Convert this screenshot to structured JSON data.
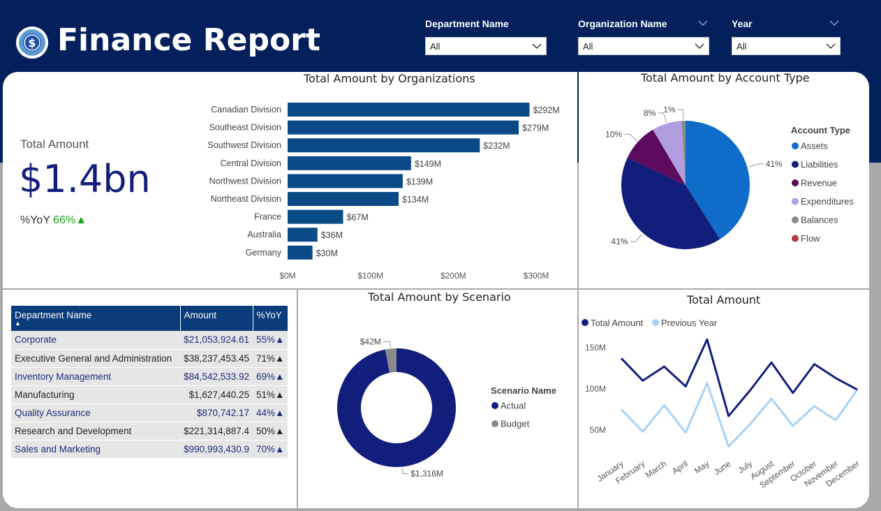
{
  "header": {
    "title": "Finance Report",
    "slicers": [
      {
        "label": "Department Name",
        "value": "All"
      },
      {
        "label": "Organization Name",
        "value": "All"
      },
      {
        "label": "Year",
        "value": "All"
      }
    ]
  },
  "kpi": {
    "label": "Total Amount",
    "value": "$1.4bn",
    "yoy_label": "%YoY",
    "yoy_value": "66%",
    "yoy_arrow": "▲"
  },
  "colors": {
    "header_bg": "#03205c",
    "bar": "#0a4a87",
    "navy": "#121e7c",
    "green": "#1aa31a",
    "light_blue": "#a7d2f5"
  },
  "chart_data": [
    {
      "type": "bar",
      "orientation": "horizontal",
      "title": "Total Amount by Organizations",
      "categories": [
        "Canadian Division",
        "Southeast Division",
        "Southwest Division",
        "Central Division",
        "Northwest Division",
        "Northeast Division",
        "France",
        "Australia",
        "Germany"
      ],
      "values": [
        292,
        279,
        232,
        149,
        139,
        134,
        67,
        36,
        30
      ],
      "data_labels": [
        "$292M",
        "$279M",
        "$232M",
        "$149M",
        "$139M",
        "$134M",
        "$67M",
        "$36M",
        "$30M"
      ],
      "xticks": [
        0,
        100,
        200,
        300
      ],
      "xtick_labels": [
        "$0M",
        "$100M",
        "$200M",
        "$300M"
      ],
      "xlim": [
        0,
        300
      ]
    },
    {
      "type": "pie",
      "title": "Total Amount by Account Type",
      "legend_title": "Account Type",
      "legend_position": "right",
      "slices": [
        {
          "name": "Assets",
          "percent": 41,
          "label": "41%",
          "color": "#0f6cc9"
        },
        {
          "name": "Liabilities",
          "percent": 41,
          "label": "41%",
          "color": "#121e7c"
        },
        {
          "name": "Revenue",
          "percent": 9.5,
          "label": "10%",
          "color": "#5c0a5e"
        },
        {
          "name": "Expenditures",
          "percent": 7.5,
          "label": "8%",
          "color": "#b19ee0"
        },
        {
          "name": "Balances",
          "percent": 1,
          "label": "1%",
          "color": "#8a8a8a"
        },
        {
          "name": "Flow",
          "percent": 0,
          "label": "",
          "color": "#b33a3a"
        }
      ]
    },
    {
      "type": "donut",
      "title": "Total Amount by Scenario",
      "legend_title": "Scenario Name",
      "legend_position": "right",
      "slices": [
        {
          "name": "Actual",
          "value": 1316,
          "label": "$1,316M",
          "color": "#121e7c"
        },
        {
          "name": "Budget",
          "value": 42,
          "label": "$42M",
          "color": "#8a8a8a"
        }
      ]
    },
    {
      "type": "line",
      "title": "Total Amount",
      "legend_position": "top-left",
      "categories": [
        "January",
        "February",
        "March",
        "April",
        "May",
        "June",
        "July",
        "August",
        "September",
        "October",
        "November",
        "December"
      ],
      "yticks": [
        50,
        100,
        150
      ],
      "ytick_labels": [
        "50M",
        "100M",
        "150M"
      ],
      "ylim": [
        25,
        165
      ],
      "grid": false,
      "series": [
        {
          "name": "Total Amount",
          "color": "#121e7c",
          "values": [
            137,
            110,
            127,
            103,
            160,
            67,
            98,
            132,
            95,
            130,
            113,
            99
          ]
        },
        {
          "name": "Previous Year",
          "color": "#a7d2f5",
          "values": [
            75,
            48,
            80,
            47,
            107,
            30,
            57,
            88,
            55,
            79,
            62,
            99
          ]
        }
      ]
    }
  ],
  "table": {
    "columns": [
      "Department Name",
      "Amount",
      "%YoY"
    ],
    "sort_indicator": "▲",
    "rows": [
      {
        "name": "Corporate",
        "amount": "$21,053,924.61",
        "yoy": "55%▲"
      },
      {
        "name": "Executive General and Administration",
        "amount": "$38,237,453.45",
        "yoy": "71%▲"
      },
      {
        "name": "Inventory Management",
        "amount": "$84,542,533.92",
        "yoy": "69%▲"
      },
      {
        "name": "Manufacturing",
        "amount": "$1,627,440.25",
        "yoy": "51%▲"
      },
      {
        "name": "Quality Assurance",
        "amount": "$870,742.17",
        "yoy": "44%▲"
      },
      {
        "name": "Research and Development",
        "amount": "$221,314,887.4",
        "yoy": "50%▲"
      },
      {
        "name": "Sales and Marketing",
        "amount": "$990,993,430.9",
        "yoy": "70%▲"
      }
    ]
  }
}
